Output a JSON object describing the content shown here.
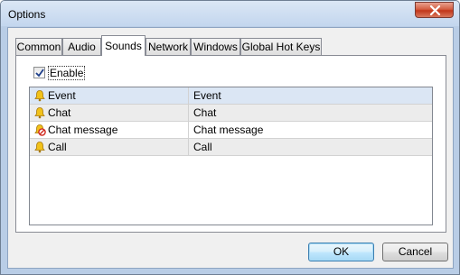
{
  "window": {
    "title": "Options"
  },
  "tabs": [
    {
      "label": "Common"
    },
    {
      "label": "Audio"
    },
    {
      "label": "Sounds",
      "active": true
    },
    {
      "label": "Network"
    },
    {
      "label": "Windows"
    },
    {
      "label": "Global Hot Keys"
    }
  ],
  "sounds": {
    "enable_label": "Enable",
    "enable_checked": true,
    "rows": [
      {
        "icon": "bell-icon",
        "event": "Event",
        "sound": "Event",
        "selected": true
      },
      {
        "icon": "bell-icon",
        "event": "Chat",
        "sound": "Chat"
      },
      {
        "icon": "bell-muted-icon",
        "event": "Chat message",
        "sound": "Chat message"
      },
      {
        "icon": "bell-icon",
        "event": "Call",
        "sound": "Call"
      }
    ]
  },
  "buttons": {
    "ok": "OK",
    "cancel": "Cancel"
  },
  "colors": {
    "selected_row": "#dbe6f4",
    "close_button": "#c9482b"
  }
}
